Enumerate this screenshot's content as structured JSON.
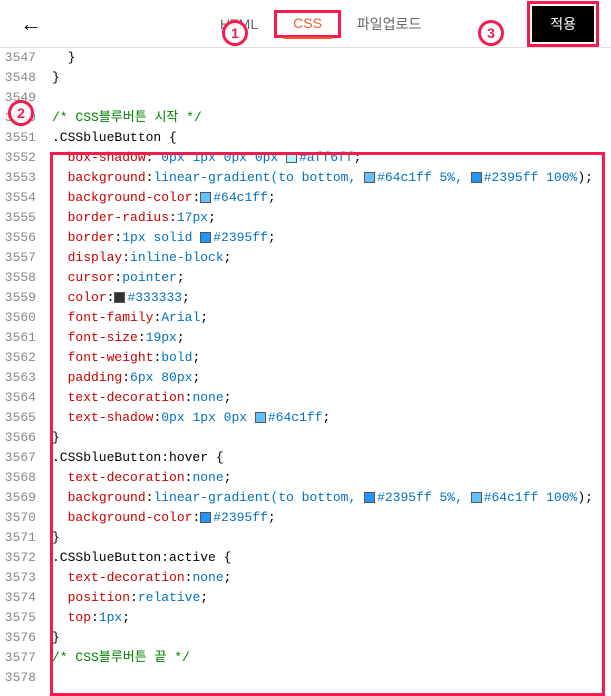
{
  "header": {
    "tabs": {
      "html": "HTML",
      "css": "CSS",
      "upload": "파일업로드"
    },
    "apply": "적용"
  },
  "badges": {
    "b1": "1",
    "b2": "2",
    "b3": "3"
  },
  "lines": [
    {
      "n": "3547",
      "t": "  }"
    },
    {
      "n": "3548",
      "t": "}"
    },
    {
      "n": "3549",
      "t": ""
    },
    {
      "n": "3550",
      "comment": "/* CSS블루버튼 시작 */"
    },
    {
      "n": "3551",
      "sel": ".CSSblueButton {"
    },
    {
      "n": "3552",
      "prop": "box-shadow",
      "val": " 0px 1px 0px 0px ",
      "swatch": "#aff6ff",
      "color": "#aff6ff",
      "tail": ";"
    },
    {
      "n": "3553",
      "prop": "background",
      "val": "linear-gradient(to bottom, ",
      "swatch": "#64c1ff",
      "color": "#64c1ff 5%",
      "mid": ", ",
      "swatch2": "#2395ff",
      "color2": "#2395ff 100%",
      "tail": ");"
    },
    {
      "n": "3554",
      "prop": "background-color",
      "val": "",
      "swatch": "#64c1ff",
      "color": "#64c1ff",
      "tail": ";"
    },
    {
      "n": "3555",
      "prop": "border-radius",
      "val": "17px",
      "tail": ";"
    },
    {
      "n": "3556",
      "prop": "border",
      "val": "1px solid ",
      "swatch": "#2395ff",
      "color": "#2395ff",
      "tail": ";"
    },
    {
      "n": "3557",
      "prop": "display",
      "val": "inline-block",
      "tail": ";"
    },
    {
      "n": "3558",
      "prop": "cursor",
      "val": "pointer",
      "tail": ";"
    },
    {
      "n": "3559",
      "prop": "color",
      "val": "",
      "swatch": "#333333",
      "color": "#333333",
      "tail": ";"
    },
    {
      "n": "3560",
      "prop": "font-family",
      "val": "Arial",
      "tail": ";"
    },
    {
      "n": "3561",
      "prop": "font-size",
      "val": "19px",
      "tail": ";"
    },
    {
      "n": "3562",
      "prop": "font-weight",
      "val": "bold",
      "tail": ";"
    },
    {
      "n": "3563",
      "prop": "padding",
      "val": "6px 80px",
      "tail": ";"
    },
    {
      "n": "3564",
      "prop": "text-decoration",
      "val": "none",
      "tail": ";"
    },
    {
      "n": "3565",
      "prop": "text-shadow",
      "val": "0px 1px 0px ",
      "swatch": "#64c1ff",
      "color": "#64c1ff",
      "tail": ";"
    },
    {
      "n": "3566",
      "sel": "}"
    },
    {
      "n": "3567",
      "sel": ".CSSblueButton:hover {"
    },
    {
      "n": "3568",
      "prop": "text-decoration",
      "val": "none",
      "tail": ";"
    },
    {
      "n": "3569",
      "prop": "background",
      "val": "linear-gradient(to bottom, ",
      "swatch": "#2395ff",
      "color": "#2395ff 5%",
      "mid": ", ",
      "swatch2": "#64c1ff",
      "color2": "#64c1ff 100%",
      "tail": ");"
    },
    {
      "n": "3570",
      "prop": "background-color",
      "val": "",
      "swatch": "#2395ff",
      "color": "#2395ff",
      "tail": ";"
    },
    {
      "n": "3571",
      "sel": "}"
    },
    {
      "n": "3572",
      "sel": ".CSSblueButton:active {"
    },
    {
      "n": "3573",
      "prop": "text-decoration",
      "val": "none",
      "tail": ";"
    },
    {
      "n": "3574",
      "prop": "position",
      "val": "relative",
      "tail": ";"
    },
    {
      "n": "3575",
      "prop": "top",
      "val": "1px",
      "tail": ";"
    },
    {
      "n": "3576",
      "sel": "}"
    },
    {
      "n": "3577",
      "comment": "/* CSS블루버튼 끝 */"
    },
    {
      "n": "3578",
      "t": ""
    }
  ]
}
